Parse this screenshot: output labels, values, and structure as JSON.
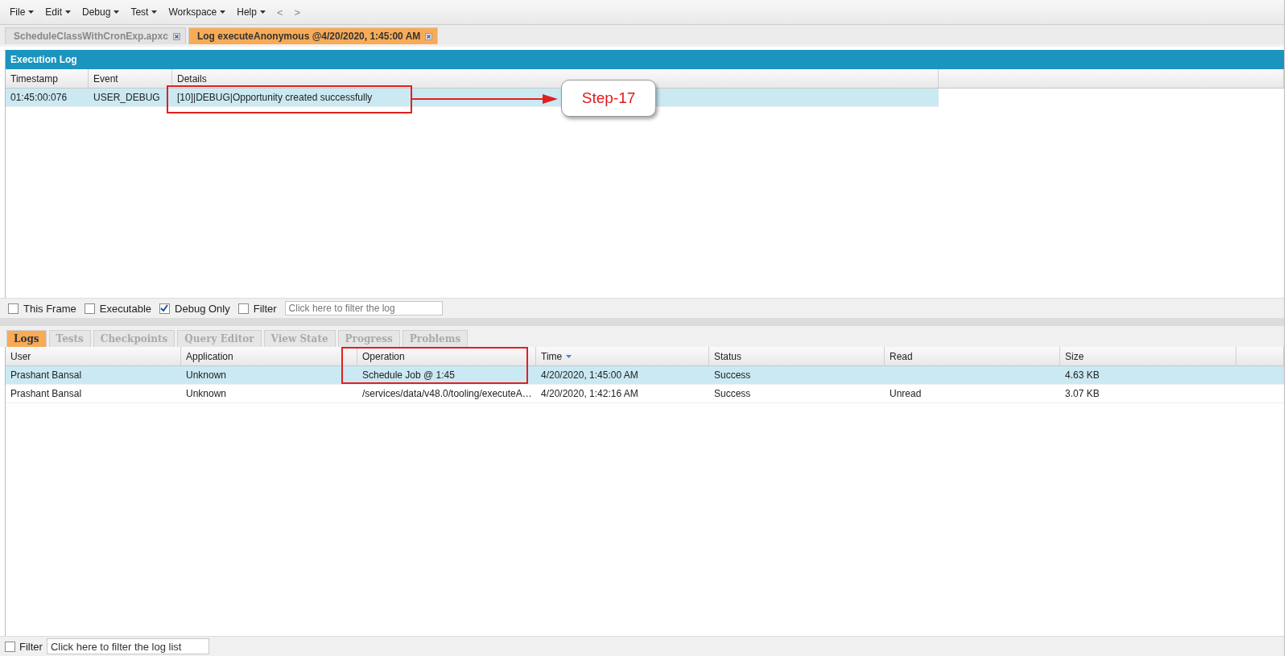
{
  "menu": [
    {
      "label": "File"
    },
    {
      "label": "Edit"
    },
    {
      "label": "Debug"
    },
    {
      "label": "Test"
    },
    {
      "label": "Workspace"
    },
    {
      "label": "Help"
    }
  ],
  "nav": [
    "<",
    ">"
  ],
  "tabs": [
    {
      "label": "ScheduleClassWithCronExp.apxc",
      "selected": false
    },
    {
      "label": "Log executeAnonymous @4/20/2020, 1:45:00 AM",
      "selected": true
    }
  ],
  "execution_log": {
    "title": "Execution Log",
    "columns": [
      {
        "label": "Timestamp"
      },
      {
        "label": "Event"
      },
      {
        "label": "Details"
      }
    ],
    "rows": [
      {
        "selected": true,
        "cells": [
          "01:45:00:076",
          "USER_DEBUG",
          "[10]|DEBUG|Opportunity created successfully"
        ]
      }
    ]
  },
  "callout": {
    "label": "Step-17"
  },
  "log_filters": [
    {
      "label": "This Frame",
      "checked": false
    },
    {
      "label": "Executable",
      "checked": false
    },
    {
      "label": "Debug Only",
      "checked": true
    },
    {
      "label": "Filter",
      "checked": false
    }
  ],
  "log_filter_field": {
    "placeholder": "Click here to filter the log"
  },
  "bottom_tabs": [
    {
      "label": "Logs",
      "selected": true
    },
    {
      "label": "Tests",
      "selected": false
    },
    {
      "label": "Checkpoints",
      "selected": false
    },
    {
      "label": "Query Editor",
      "selected": false
    },
    {
      "label": "View State",
      "selected": false
    },
    {
      "label": "Progress",
      "selected": false
    },
    {
      "label": "Problems",
      "selected": false
    }
  ],
  "logs_table": {
    "columns": [
      {
        "label": "User",
        "sorted": false
      },
      {
        "label": "Application",
        "sorted": false
      },
      {
        "label": "Operation",
        "sorted": false
      },
      {
        "label": "Time",
        "sorted": true
      },
      {
        "label": "Status",
        "sorted": false
      },
      {
        "label": "Read",
        "sorted": false
      },
      {
        "label": "Size",
        "sorted": false
      }
    ],
    "rows": [
      {
        "selected": true,
        "cells": [
          "Prashant Bansal",
          "Unknown",
          "Schedule Job @ 1:45",
          "4/20/2020, 1:45:00 AM",
          "Success",
          "",
          "4.63 KB"
        ]
      },
      {
        "selected": false,
        "cells": [
          "Prashant Bansal",
          "Unknown",
          "/services/data/v48.0/tooling/executeA…",
          "4/20/2020, 1:42:16 AM",
          "Success",
          "Unread",
          "3.07 KB"
        ]
      }
    ]
  },
  "bottom_filter": {
    "label": "Filter",
    "checked": false,
    "placeholder": "Click here to filter the log list"
  }
}
